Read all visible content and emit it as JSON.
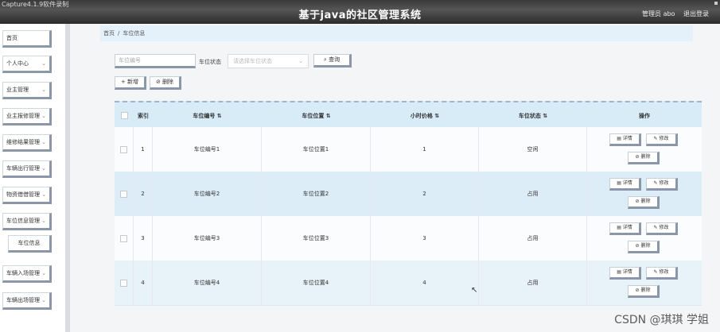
{
  "window": {
    "capture_text": "Capture4.1.9软件录制"
  },
  "header": {
    "title": "基于java的社区管理系统",
    "user": "管理员 abo",
    "logout": "退出登录"
  },
  "sidebar": {
    "items": [
      {
        "label": "首页",
        "chev": ""
      },
      {
        "label": "个人中心",
        "chev": "⌄"
      },
      {
        "label": "业主管理",
        "chev": "⌄"
      },
      {
        "label": "业主报修管理",
        "chev": "⌄"
      },
      {
        "label": "维修结果管理",
        "chev": "⌄"
      },
      {
        "label": "车辆出行管理",
        "chev": "⌄"
      },
      {
        "label": "物资借借管理",
        "chev": "⌄"
      },
      {
        "label": "车位信息管理",
        "chev": "⌄"
      },
      {
        "label": "车位信息",
        "chev": ""
      },
      {
        "label": "车辆入场管理",
        "chev": "⌄"
      },
      {
        "label": "车辆出场管理",
        "chev": "⌄"
      }
    ]
  },
  "breadcrumb": {
    "home": "首页",
    "sep": "/",
    "current": "车位信息"
  },
  "search": {
    "placeholder": "车位编号",
    "status_label": "车位状态",
    "status_placeholder": "请选择车位状态",
    "query_button": "⌕ 查询"
  },
  "toolbar": {
    "add": "+ 新增",
    "delete": "⊘ 删除"
  },
  "table": {
    "headers": [
      "索引",
      "车位编号 ⇅",
      "车位位置 ⇅",
      "小时价格 ⇅",
      "车位状态 ⇅",
      "操作"
    ],
    "rows": [
      {
        "index": "1",
        "code": "车位编号1",
        "location": "车位位置1",
        "price": "1",
        "status": "空闲"
      },
      {
        "index": "2",
        "code": "车位编号2",
        "location": "车位位置2",
        "price": "2",
        "status": "占用"
      },
      {
        "index": "3",
        "code": "车位编号3",
        "location": "车位位置3",
        "price": "3",
        "status": "占用"
      },
      {
        "index": "4",
        "code": "车位编号4",
        "location": "车位位置4",
        "price": "4",
        "status": "占用"
      }
    ],
    "ops": {
      "detail": "▤ 详情",
      "edit": "✎ 修改",
      "remove": "⊘ 删除"
    }
  },
  "watermark": "CSDN @琪琪 学姐"
}
